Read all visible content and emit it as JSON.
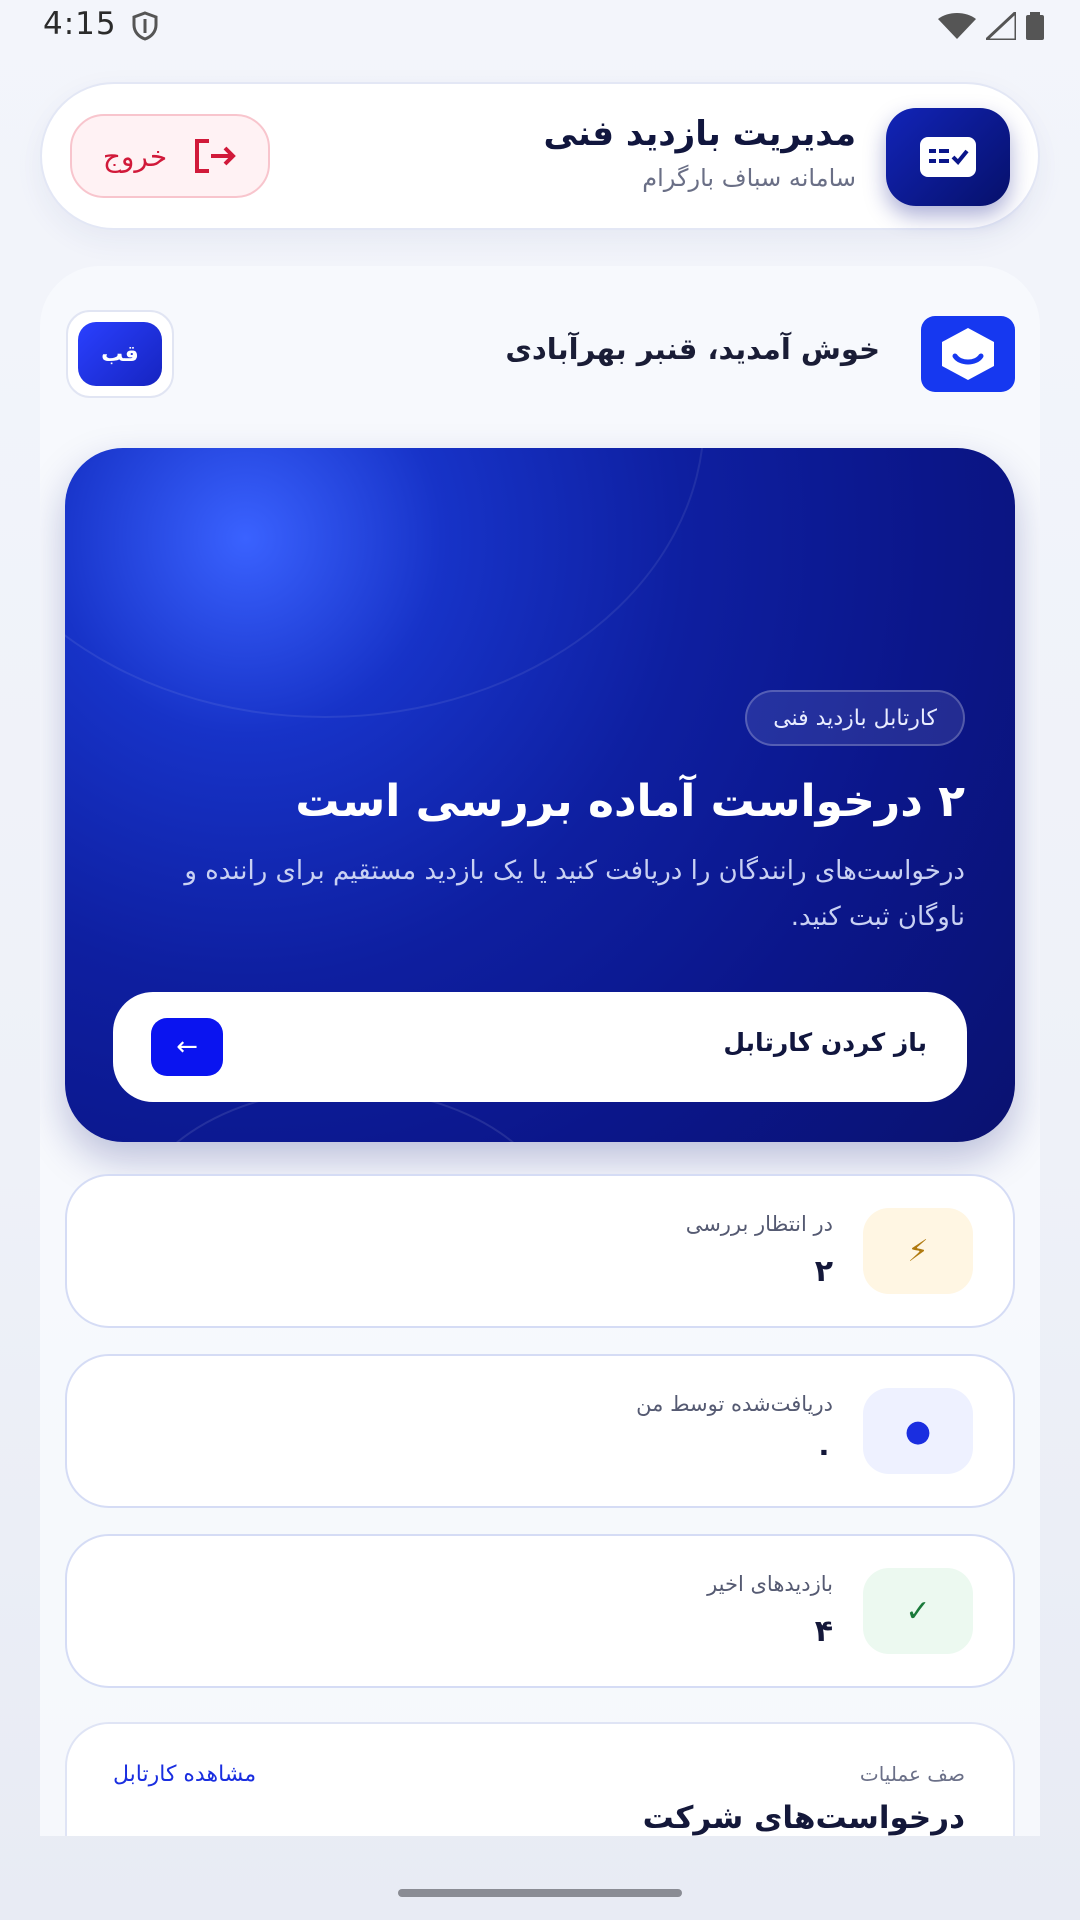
{
  "status_bar": {
    "time": "4:15"
  },
  "header": {
    "title": "مدیریت بازدید فنی",
    "subtitle": "سامانه سباف بارگرام",
    "logout_label": "خروج"
  },
  "welcome": {
    "text": "خوش آمدید، قنبر بهرآبادی",
    "avatar_initials": "قب"
  },
  "hero": {
    "badge": "کارتابل بازدید فنی",
    "title": "۲ درخواست آماده بررسی است",
    "description": "درخواست‌های رانندگان را دریافت کنید یا یک بازدید مستقیم برای راننده و ناوگان ثبت کنید.",
    "button_label": "باز کردن کارتابل",
    "button_arrow": "←"
  },
  "stats": [
    {
      "label": "در انتظار بررسی",
      "value": "۲",
      "icon": "lightning-icon",
      "icon_glyph": "⚡",
      "icon_bg": "#fff6e3",
      "icon_color": "#b07a10"
    },
    {
      "label": "دریافت‌شده توسط من",
      "value": "۰",
      "icon": "dot-icon",
      "icon_glyph": "●",
      "icon_bg": "#eef1ff",
      "icon_color": "#1a2ee0"
    },
    {
      "label": "بازدیدهای اخیر",
      "value": "۴",
      "icon": "check-icon",
      "icon_glyph": "✓",
      "icon_bg": "#ecf9f0",
      "icon_color": "#1a7a3a"
    }
  ],
  "queue": {
    "kicker": "صف عملیات",
    "title": "درخواست‌های شرکت",
    "link": "مشاهده کارتابل"
  },
  "colors": {
    "accent": "#0a14f0",
    "hero_dark": "#0a1270",
    "danger": "#d11a3a"
  }
}
